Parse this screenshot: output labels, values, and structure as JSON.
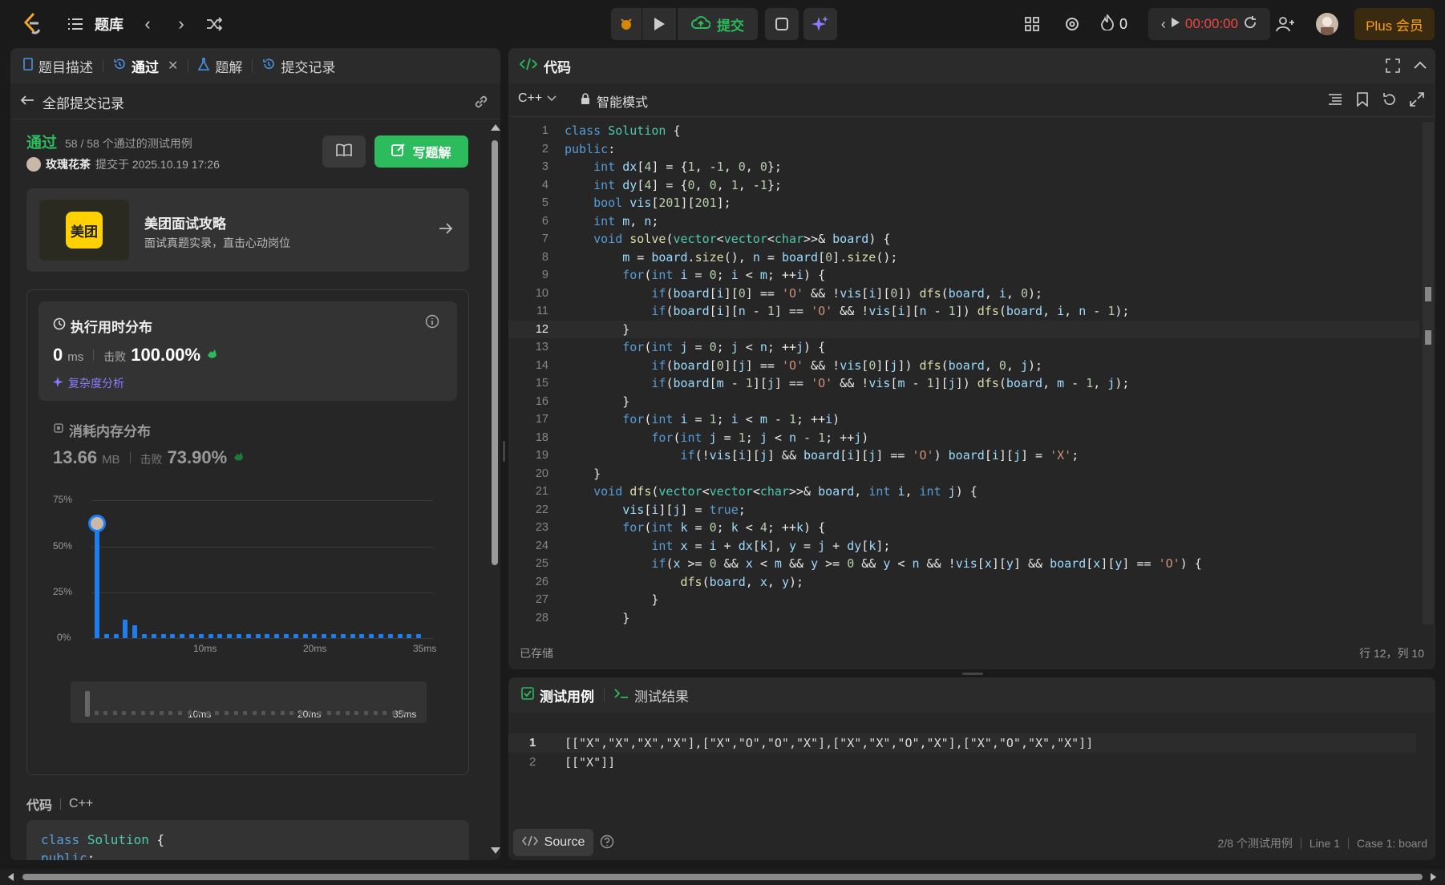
{
  "topbar": {
    "problems_label": "题库",
    "submit_label": "提交",
    "streak": "0",
    "timer": "00:00:00",
    "plus_label": "Plus 会员"
  },
  "left": {
    "tabs": [
      {
        "label": "题目描述"
      },
      {
        "label": "通过"
      },
      {
        "label": "题解"
      },
      {
        "label": "提交记录"
      }
    ],
    "back_label": "全部提交记录",
    "status": "通过",
    "testcases": "58 / 58 个通过的测试用例",
    "user": "玫瑰花茶",
    "submitted_at": "提交于 2025.10.19 17:26",
    "write_solution": "写题解",
    "promo": {
      "logo_text": "美团",
      "title": "美团面试攻略",
      "subtitle": "面试真题实录，直击心动岗位"
    },
    "runtime": {
      "title": "执行用时分布",
      "value": "0",
      "unit": "ms",
      "beats_label": "击败",
      "beats": "100.00%",
      "analysis": "复杂度分析"
    },
    "memory": {
      "title": "消耗内存分布",
      "value": "13.66",
      "unit": "MB",
      "beats_label": "击败",
      "beats": "73.90%"
    },
    "code_label": "代码",
    "lang": "C++",
    "code_preview": [
      "class Solution {",
      "public:"
    ]
  },
  "chart_data": {
    "type": "bar",
    "ylabel": "",
    "xlabel": "",
    "yticks": [
      "75%",
      "50%",
      "25%",
      "0%"
    ],
    "xticks": [
      "10ms",
      "20ms",
      "35ms"
    ],
    "ylim": [
      0,
      75
    ],
    "values": [
      62,
      2,
      2,
      10,
      7,
      2,
      2,
      2,
      2,
      2,
      2,
      2,
      2,
      2,
      2,
      2,
      2,
      2,
      2,
      2,
      2,
      2,
      2,
      2,
      2,
      2,
      2,
      2,
      2,
      2,
      2,
      2,
      2,
      2,
      2
    ],
    "highlight_index": 0,
    "mini_xticks": [
      "10ms",
      "20ms",
      "35ms"
    ]
  },
  "editor": {
    "title": "代码",
    "lang": "C++",
    "mode": "智能模式",
    "saved": "已存储",
    "cursor": "行 12，列 10",
    "code": [
      "class Solution {",
      "public:",
      "    int dx[4] = {1, -1, 0, 0};",
      "    int dy[4] = {0, 0, 1, -1};",
      "    bool vis[201][201];",
      "    int m, n;",
      "    void solve(vector<vector<char>>& board) {",
      "        m = board.size(), n = board[0].size();",
      "        for(int i = 0; i < m; ++i) {",
      "            if(board[i][0] == 'O' && !vis[i][0]) dfs(board, i, 0);",
      "            if(board[i][n - 1] == 'O' && !vis[i][n - 1]) dfs(board, i, n - 1);",
      "        }",
      "        for(int j = 0; j < n; ++j) {",
      "            if(board[0][j] == 'O' && !vis[0][j]) dfs(board, 0, j);",
      "            if(board[m - 1][j] == 'O' && !vis[m - 1][j]) dfs(board, m - 1, j);",
      "        }",
      "        for(int i = 1; i < m - 1; ++i)",
      "            for(int j = 1; j < n - 1; ++j)",
      "                if(!vis[i][j] && board[i][j] == 'O') board[i][j] = 'X';",
      "    }",
      "    void dfs(vector<vector<char>>& board, int i, int j) {",
      "        vis[i][j] = true;",
      "        for(int k = 0; k < 4; ++k) {",
      "            int x = i + dx[k], y = j + dy[k];",
      "            if(x >= 0 && x < m && y >= 0 && y < n && !vis[x][y] && board[x][y] == 'O') {",
      "                dfs(board, x, y);",
      "            }",
      "        }"
    ],
    "active_line": 12
  },
  "testpanel": {
    "tab_cases": "测试用例",
    "tab_results": "测试结果",
    "lines": [
      "[[\"X\",\"X\",\"X\",\"X\"],[\"X\",\"O\",\"O\",\"X\"],[\"X\",\"X\",\"O\",\"X\"],[\"X\",\"O\",\"X\",\"X\"]]",
      "[[\"X\"]]"
    ],
    "source_label": "Source",
    "footer": {
      "count": "2/8 个测试用例",
      "line": "Line 1",
      "case": "Case 1: board"
    }
  }
}
